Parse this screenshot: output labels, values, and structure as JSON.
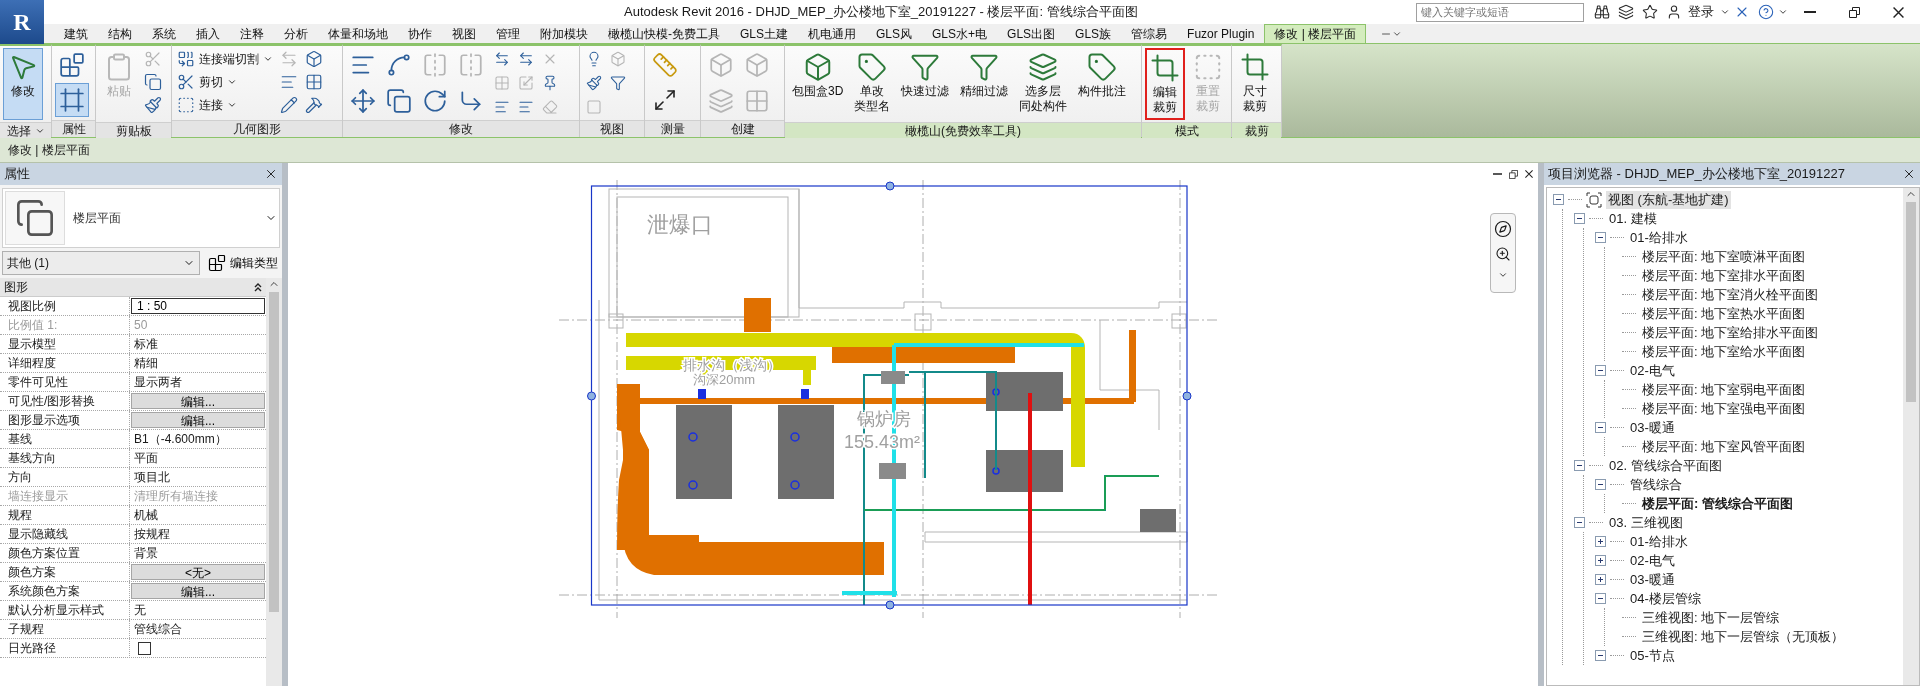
{
  "window": {
    "app_button": "R",
    "title": "Autodesk Revit 2016 -    DHJD_MEP_办公楼地下室_20191227 - 楼层平面: 管线综合平面图",
    "search": {
      "placeholder": "键入关键字或短语"
    },
    "login": "登录"
  },
  "tabs": [
    {
      "label": "建筑",
      "selected": false
    },
    {
      "label": "结构",
      "selected": false
    },
    {
      "label": "系统",
      "selected": false
    },
    {
      "label": "插入",
      "selected": false
    },
    {
      "label": "注释",
      "selected": false
    },
    {
      "label": "分析",
      "selected": false
    },
    {
      "label": "体量和场地",
      "selected": false
    },
    {
      "label": "协作",
      "selected": false
    },
    {
      "label": "视图",
      "selected": false
    },
    {
      "label": "管理",
      "selected": false
    },
    {
      "label": "附加模块",
      "selected": false
    },
    {
      "label": "橄榄山快模-免费工具",
      "selected": false
    },
    {
      "label": "GLS土建",
      "selected": false
    },
    {
      "label": "机电通用",
      "selected": false
    },
    {
      "label": "GLS风",
      "selected": false
    },
    {
      "label": "GLS水+电",
      "selected": false
    },
    {
      "label": "GLS出图",
      "selected": false
    },
    {
      "label": "GLS族",
      "selected": false
    },
    {
      "label": "管综易",
      "selected": false
    },
    {
      "label": "Fuzor Plugin",
      "selected": false
    },
    {
      "label": "修改 | 楼层平面",
      "selected": true
    }
  ],
  "ribbon": {
    "panels": [
      {
        "title": "选择",
        "tools": [
          {
            "lines": [
              "修改"
            ],
            "selected": true
          }
        ]
      },
      {
        "title": "属性",
        "toggles": [
          {
            "selected": false
          },
          {
            "selected": true
          }
        ]
      },
      {
        "title": "剪贴板",
        "tools": [
          {
            "lines": [
              "粘贴"
            ],
            "disabled": true
          }
        ]
      },
      {
        "title": "几何图形",
        "tools": [
          {
            "lines": [
              "连接端切割"
            ]
          },
          {
            "lines": [
              "剪切"
            ]
          },
          {
            "lines": [
              "连接"
            ]
          }
        ]
      },
      {
        "title": "修改"
      },
      {
        "title": "视图"
      },
      {
        "title": "测量"
      },
      {
        "title": "创建"
      },
      {
        "title": "橄榄山(免费效率工具)",
        "tools": [
          {
            "lines": [
              "包围盒3D"
            ]
          },
          {
            "lines": [
              "单改",
              "类型名"
            ]
          },
          {
            "lines": [
              "快速过滤"
            ]
          },
          {
            "lines": [
              "精细过滤"
            ]
          },
          {
            "lines": [
              "选多层",
              "同处构件"
            ]
          },
          {
            "lines": [
              "构件批注"
            ]
          }
        ]
      },
      {
        "title": "模式",
        "tools": [
          {
            "lines": [
              "编辑",
              "裁剪"
            ],
            "disabled": false,
            "highlighted": true
          },
          {
            "lines": [
              "重置",
              "裁剪"
            ],
            "disabled": true,
            "highlighted": false
          }
        ]
      },
      {
        "title": "裁剪",
        "tools": [
          {
            "lines": [
              "尺寸",
              "裁剪"
            ]
          }
        ]
      }
    ]
  },
  "context_bar": "修改 | 楼层平面",
  "properties": {
    "title": "属性",
    "type_name": "楼层平面",
    "filter": "其他 (1)",
    "edit_type": "编辑类型",
    "group": "图形",
    "rows": [
      {
        "kind": "input",
        "label": "视图比例",
        "value": "1 : 50",
        "disabled": false
      },
      {
        "kind": "text",
        "label": "比例值 1:",
        "value": "50",
        "disabled": true
      },
      {
        "kind": "text",
        "label": "显示模型",
        "value": "标准",
        "disabled": false
      },
      {
        "kind": "text",
        "label": "详细程度",
        "value": "精细",
        "disabled": false
      },
      {
        "kind": "text",
        "label": "零件可见性",
        "value": "显示两者",
        "disabled": false
      },
      {
        "kind": "button",
        "label": "可见性/图形替换",
        "value": "编辑...",
        "disabled": false
      },
      {
        "kind": "button",
        "label": "图形显示选项",
        "value": "编辑...",
        "disabled": false
      },
      {
        "kind": "text",
        "label": "基线",
        "value": "B1（-4.600mm）",
        "disabled": false
      },
      {
        "kind": "text",
        "label": "基线方向",
        "value": "平面",
        "disabled": false
      },
      {
        "kind": "text",
        "label": "方向",
        "value": "项目北",
        "disabled": false
      },
      {
        "kind": "text",
        "label": "墙连接显示",
        "value": "清理所有墙连接",
        "disabled": true
      },
      {
        "kind": "text",
        "label": "规程",
        "value": "机械",
        "disabled": false
      },
      {
        "kind": "text",
        "label": "显示隐藏线",
        "value": "按规程",
        "disabled": false
      },
      {
        "kind": "text",
        "label": "颜色方案位置",
        "value": "背景",
        "disabled": false
      },
      {
        "kind": "button",
        "label": "颜色方案",
        "value": "<无>",
        "disabled": false
      },
      {
        "kind": "button",
        "label": "系统颜色方案",
        "value": "编辑...",
        "disabled": false
      },
      {
        "kind": "text",
        "label": "默认分析显示样式",
        "value": "无",
        "disabled": false
      },
      {
        "kind": "text",
        "label": "子规程",
        "value": "管线综合",
        "disabled": false
      },
      {
        "kind": "checkbox",
        "label": "日光路径",
        "checked": false,
        "disabled": false
      }
    ]
  },
  "plan": {
    "labels": [
      "泄爆口",
      "排水沟（浅沟）",
      "沟深20mm",
      "锅炉房",
      "155.43m²"
    ]
  },
  "browser": {
    "title": "项目浏览器 - DHJD_MEP_办公楼地下室_20191227",
    "tree": [
      {
        "kind": "group",
        "label": "视图 (东航-基地扩建)",
        "expanded": true,
        "selected": true,
        "children": [
          {
            "kind": "group",
            "label": "01. 建模",
            "expanded": true,
            "selected": false,
            "children": [
              {
                "kind": "group",
                "label": "01-给排水",
                "expanded": true,
                "selected": false,
                "children": [
                  {
                    "kind": "view",
                    "label": "楼层平面: 地下室喷淋平面图",
                    "current": false,
                    "selected": false
                  },
                  {
                    "kind": "view",
                    "label": "楼层平面: 地下室排水平面图",
                    "current": false,
                    "selected": false
                  },
                  {
                    "kind": "view",
                    "label": "楼层平面: 地下室消火栓平面图",
                    "current": false,
                    "selected": false
                  },
                  {
                    "kind": "view",
                    "label": "楼层平面: 地下室热水平面图",
                    "current": false,
                    "selected": false
                  },
                  {
                    "kind": "view",
                    "label": "楼层平面: 地下室给排水平面图",
                    "current": false,
                    "selected": false
                  },
                  {
                    "kind": "view",
                    "label": "楼层平面: 地下室给水平面图",
                    "current": false,
                    "selected": false
                  }
                ]
              },
              {
                "kind": "group",
                "label": "02-电气",
                "expanded": true,
                "selected": false,
                "children": [
                  {
                    "kind": "view",
                    "label": "楼层平面: 地下室弱电平面图",
                    "current": false,
                    "selected": false
                  },
                  {
                    "kind": "view",
                    "label": "楼层平面: 地下室强电平面图",
                    "current": false,
                    "selected": false
                  }
                ]
              },
              {
                "kind": "group",
                "label": "03-暖通",
                "expanded": true,
                "selected": false,
                "children": [
                  {
                    "kind": "view",
                    "label": "楼层平面: 地下室风管平面图",
                    "current": false,
                    "selected": false
                  }
                ]
              }
            ]
          },
          {
            "kind": "group",
            "label": "02. 管线综合平面图",
            "expanded": true,
            "selected": false,
            "children": [
              {
                "kind": "group",
                "label": "管线综合",
                "expanded": true,
                "selected": false,
                "children": [
                  {
                    "kind": "view",
                    "label": "楼层平面: 管线综合平面图",
                    "current": true,
                    "selected": false
                  }
                ]
              }
            ]
          },
          {
            "kind": "group",
            "label": "03. 三维视图",
            "expanded": true,
            "selected": false,
            "children": [
              {
                "kind": "group",
                "label": "01-给排水",
                "expanded": false,
                "selected": false
              },
              {
                "kind": "group",
                "label": "02-电气",
                "expanded": false,
                "selected": false
              },
              {
                "kind": "group",
                "label": "03-暖通",
                "expanded": false,
                "selected": false
              },
              {
                "kind": "group",
                "label": "04-楼层管综",
                "expanded": true,
                "selected": false,
                "children": [
                  {
                    "kind": "view",
                    "label": "三维视图: 地下一层管综",
                    "current": false,
                    "selected": false
                  },
                  {
                    "kind": "view",
                    "label": "三维视图: 地下一层管综（无顶板）",
                    "current": false,
                    "selected": false
                  }
                ]
              },
              {
                "kind": "group",
                "label": "05-节点",
                "expanded": true,
                "selected": false
              }
            ]
          }
        ]
      }
    ]
  }
}
